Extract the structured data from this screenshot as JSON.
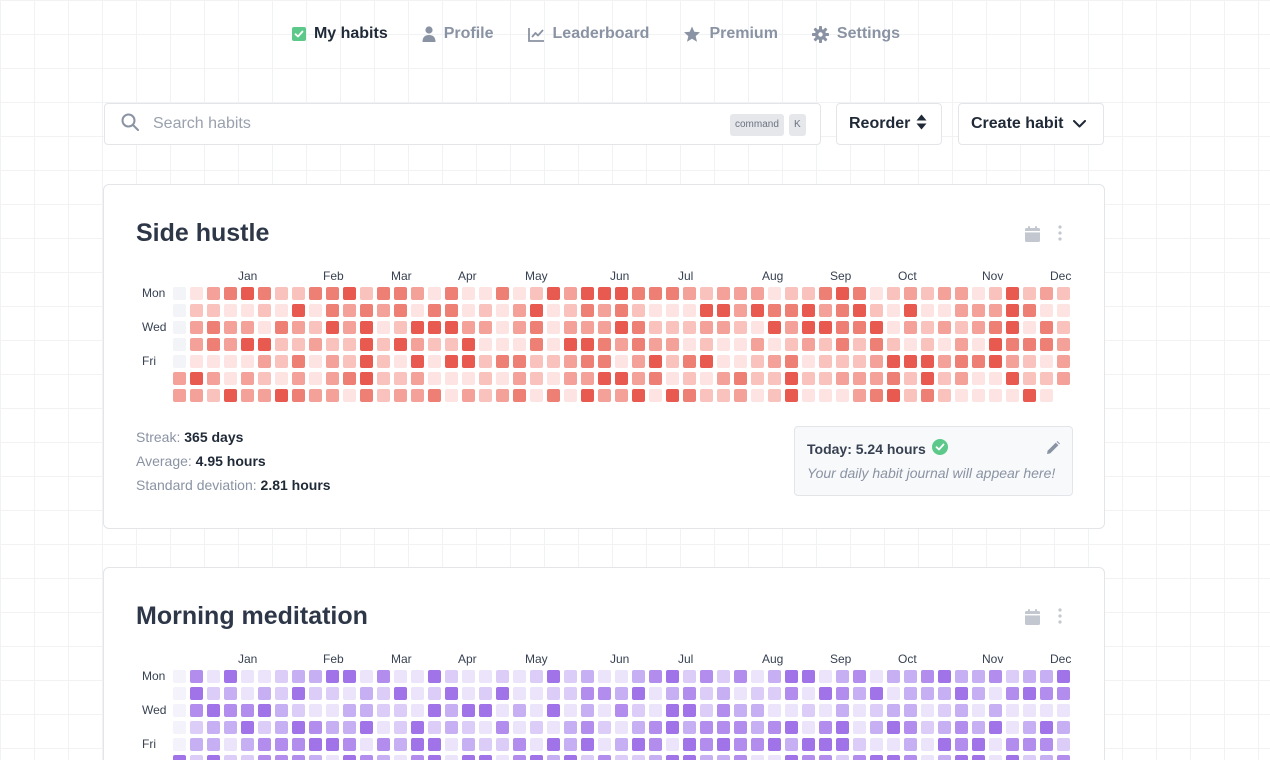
{
  "nav": {
    "items": [
      {
        "label": "My habits",
        "active": true,
        "icon": "check-square-icon"
      },
      {
        "label": "Profile",
        "active": false,
        "icon": "user-icon"
      },
      {
        "label": "Leaderboard",
        "active": false,
        "icon": "chart-line-icon"
      },
      {
        "label": "Premium",
        "active": false,
        "icon": "star-icon"
      },
      {
        "label": "Settings",
        "active": false,
        "icon": "gear-icon"
      }
    ]
  },
  "toolbar": {
    "search_placeholder": "Search habits",
    "shortcut_modifier": "command",
    "shortcut_key": "K",
    "reorder_label": "Reorder",
    "create_label": "Create habit"
  },
  "calendar": {
    "months": [
      "Jan",
      "Feb",
      "Mar",
      "Apr",
      "May",
      "Jun",
      "Jul",
      "Aug",
      "Sep",
      "Oct",
      "Nov",
      "Dec"
    ],
    "day_labels": [
      "Mon",
      "Wed",
      "Fri"
    ]
  },
  "habits": [
    {
      "title": "Side hustle",
      "palette": [
        "#f3f4f8",
        "#fde3e1",
        "#f9c2bd",
        "#f4a199",
        "#ee7f75",
        "#e85a50"
      ],
      "streak_label": "Streak:",
      "streak_value": "365 days",
      "average_label": "Average:",
      "average_value": "4.95 hours",
      "stddev_label": "Standard deviation:",
      "stddev_value": "2.81 hours",
      "today_label": "Today: 5.24 hours",
      "journal_placeholder": "Your daily habit journal will appear here!",
      "seed": 7
    },
    {
      "title": "Morning meditation",
      "palette": [
        "#f4f2fb",
        "#ebe4fb",
        "#dccdf8",
        "#c7aff3",
        "#b28ded",
        "#a173e8"
      ],
      "seed": 19
    }
  ]
}
